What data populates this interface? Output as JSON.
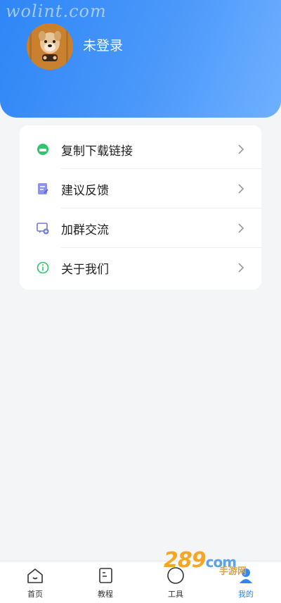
{
  "watermark": "wolint.com",
  "profile": {
    "username": "未登录"
  },
  "menu": [
    {
      "label": "复制下载链接",
      "icon": "download-link-icon"
    },
    {
      "label": "建议反馈",
      "icon": "feedback-icon"
    },
    {
      "label": "加群交流",
      "icon": "join-group-icon"
    },
    {
      "label": "关于我们",
      "icon": "info-icon"
    }
  ],
  "tabs": [
    {
      "label": "首页",
      "icon": "home-icon"
    },
    {
      "label": "教程",
      "icon": "tutorial-icon"
    },
    {
      "label": "工具",
      "icon": "tools-icon"
    },
    {
      "label": "我的",
      "icon": "profile-icon",
      "active": true
    }
  ],
  "bottom_watermark": {
    "logo": "289",
    "domain": "com",
    "text": "手游网"
  },
  "colors": {
    "accent": "#2f86f6",
    "header_start": "#2f86f6",
    "header_end": "#6fb0ff",
    "menu_green": "#31c46b",
    "menu_purple": "#7f86e8"
  }
}
